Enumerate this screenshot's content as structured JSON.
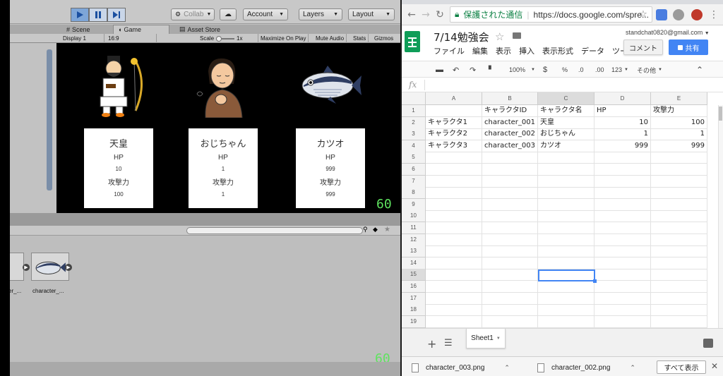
{
  "unity": {
    "toolbar": {
      "collab_label": "Collab",
      "account_label": "Account",
      "layers_label": "Layers",
      "layout_label": "Layout"
    },
    "tabs": {
      "scene": "Scene",
      "game": "Game",
      "asset_store": "Asset Store"
    },
    "game_bar": {
      "display": "Display 1",
      "aspect": "16:9",
      "scale_label": "Scale",
      "scale_value": "1x",
      "maximize": "Maximize On Play",
      "mute": "Mute Audio",
      "stats": "Stats",
      "gizmos": "Gizmos"
    },
    "characters": [
      {
        "name": "天皇",
        "hp_label": "HP",
        "hp": "10",
        "atk_label": "攻撃力",
        "atk": "100"
      },
      {
        "name": "おじちゃん",
        "hp_label": "HP",
        "hp": "1",
        "atk_label": "攻撃力",
        "atk": "1"
      },
      {
        "name": "カツオ",
        "hp_label": "HP",
        "hp": "999",
        "atk_label": "攻撃力",
        "atk": "999"
      }
    ],
    "fps_top": "60",
    "fps_bottom": "60",
    "project": {
      "assets": [
        "er_...",
        "character_..."
      ]
    }
  },
  "browser": {
    "omnibox": {
      "secure_label": "保護された通信",
      "url": "https://docs.google.com/spre..."
    },
    "sheets": {
      "title": "7/14勉強会",
      "user_email": "standchat0820@gmail.com",
      "menu": [
        "ファイル",
        "編集",
        "表示",
        "挿入",
        "表示形式",
        "データ",
        "ツー"
      ],
      "comment_label": "コメント",
      "share_label": "共有",
      "toolbar": {
        "zoom": "100%",
        "percent": "%",
        "dec_less": ".0",
        "dec_more": ".00",
        "format": "123",
        "more": "その他"
      },
      "fx": "fx",
      "columns": [
        "A",
        "B",
        "C",
        "D",
        "E"
      ],
      "rows": [
        "1",
        "2",
        "3",
        "4",
        "5",
        "6",
        "7",
        "8",
        "9",
        "10",
        "11",
        "12",
        "13",
        "14",
        "15",
        "16",
        "17",
        "18",
        "19"
      ],
      "cells": [
        [
          "",
          "キャラクタID",
          "キャラクタ名",
          "HP",
          "攻撃力"
        ],
        [
          "キャラクタ1",
          "character_001",
          "天皇",
          "10",
          "100"
        ],
        [
          "キャラクタ2",
          "character_002",
          "おじちゃん",
          "1",
          "1"
        ],
        [
          "キャラクタ3",
          "character_003",
          "カツオ",
          "999",
          "999"
        ]
      ],
      "sheet_tab": "Sheet1"
    },
    "downloads": {
      "items": [
        "character_003.png",
        "character_002.png"
      ],
      "show_all": "すべて表示"
    }
  }
}
